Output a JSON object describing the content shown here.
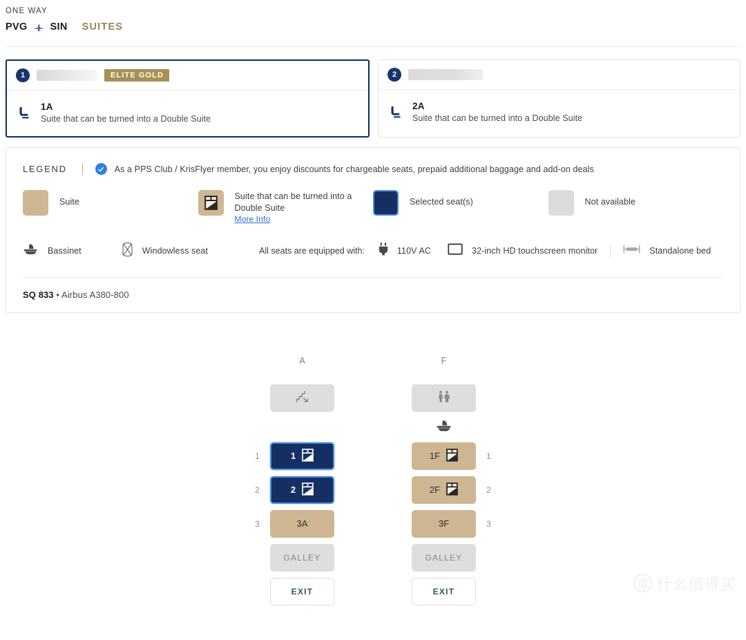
{
  "header": {
    "trip_type": "ONE WAY",
    "origin": "PVG",
    "destination": "SIN",
    "plane_icon": "airplane-icon",
    "cabin_class": "SUITES"
  },
  "passengers": [
    {
      "number": "1",
      "name_redacted": true,
      "tier_badge": "ELITE GOLD",
      "seat": "1A",
      "seat_description": "Suite that can be turned into a Double Suite",
      "seat_icon": "seat-icon",
      "active": true
    },
    {
      "number": "2",
      "name_redacted": true,
      "tier_badge": "",
      "seat": "2A",
      "seat_description": "Suite that can be turned into a Double Suite",
      "seat_icon": "seat-icon",
      "active": false
    }
  ],
  "legend": {
    "title": "LEGEND",
    "pps_icon": "check-circle-icon",
    "pps_note": "As a PPS Club / KrisFlyer member, you enjoy discounts for chargeable seats, prepaid additional baggage and add-on deals",
    "items": [
      {
        "key": "suite",
        "label": "Suite",
        "swatch": "suite",
        "icon": ""
      },
      {
        "key": "double",
        "label": "Suite that can be turned into a Double Suite",
        "more_info": "More Info",
        "swatch": "double",
        "icon": "double-suite-icon"
      },
      {
        "key": "selected",
        "label": "Selected seat(s)",
        "swatch": "selected",
        "icon": ""
      },
      {
        "key": "unavail",
        "label": "Not available",
        "swatch": "unavail",
        "icon": ""
      }
    ],
    "features": {
      "bassinet_icon": "bassinet-icon",
      "bassinet_label": "Bassinet",
      "windowless_icon": "windowless-seat-icon",
      "windowless_label": "Windowless seat",
      "equipped_label": "All seats are equipped with:",
      "power_icon": "power-plug-icon",
      "power_label": "110V AC",
      "monitor_icon": "monitor-icon",
      "monitor_label": "32-inch HD touchscreen monitor",
      "bed_icon": "standalone-bed-icon",
      "bed_label": "Standalone bed"
    }
  },
  "flight": {
    "number": "SQ 833",
    "separator": "•",
    "aircraft": "Airbus A380-800"
  },
  "seatmap": {
    "column_labels": [
      "A",
      "F"
    ],
    "facility_row": {
      "left": {
        "type": "facility",
        "icon": "stairs-icon",
        "label": ""
      },
      "right": {
        "type": "facility",
        "icon": "lavatory-icon",
        "label": ""
      }
    },
    "bassinet_marker": {
      "left": "",
      "right": "bassinet-icon"
    },
    "rows": [
      {
        "row_number": "1",
        "left": {
          "label": "1",
          "state": "selected",
          "icon": "double-suite-icon",
          "seat_id": "1A"
        },
        "right": {
          "label": "1F",
          "state": "suite",
          "icon": "double-suite-icon",
          "seat_id": "1F"
        }
      },
      {
        "row_number": "2",
        "left": {
          "label": "2",
          "state": "selected",
          "icon": "double-suite-icon",
          "seat_id": "2A"
        },
        "right": {
          "label": "2F",
          "state": "suite",
          "icon": "double-suite-icon",
          "seat_id": "2F"
        }
      },
      {
        "row_number": "3",
        "left": {
          "label": "3A",
          "state": "suite",
          "icon": "",
          "seat_id": "3A"
        },
        "right": {
          "label": "3F",
          "state": "suite",
          "icon": "",
          "seat_id": "3F"
        }
      }
    ],
    "galley_label": "GALLEY",
    "exit_label": "EXIT"
  },
  "watermark": {
    "mark": "值",
    "text": "什么值得买"
  },
  "colors": {
    "navy": "#17356b",
    "selected_seat": "#162f63",
    "selected_border": "#4a90e2",
    "suite_tan": "#ceb693",
    "gold_badge": "#a89055",
    "gold_text": "#9a8256",
    "unavailable": "#dcdcdc",
    "exit_text": "#2f5d52",
    "link_blue": "#2f6fd0"
  }
}
